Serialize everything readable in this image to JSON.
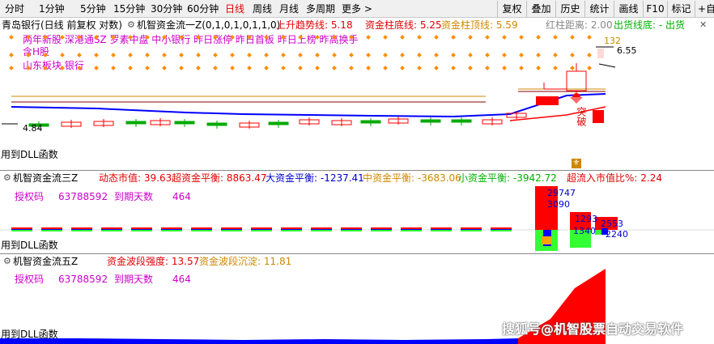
{
  "toolbar": {
    "periods": [
      "分时",
      "1分钟",
      "5分钟",
      "15分钟",
      "30分钟",
      "60分钟",
      "日线",
      "周线",
      "月线",
      "多周期",
      "更多 >"
    ],
    "active_period": "日线",
    "buttons": [
      "复权",
      "叠加",
      "历史",
      "统计",
      "画线",
      "F10",
      "标记",
      "+自"
    ]
  },
  "main_pane": {
    "title": "青岛银行(日线 前复权 对数)",
    "indicator": "机智资金流一Z(0,1,0,1,0,1,1,0)",
    "trend_line": "上升趋势线: 5.18",
    "fund_bottom": "资金柱底线: 5.25",
    "fund_top": "资金柱顶线: 5.59",
    "red_distance": "红柱距离: 2.00",
    "sell_line": "出货线底: - 出货",
    "concepts_line1": "两年新股 深港通SZ 罗素中盘 中小银行 昨日涨停 昨日首板 昨日上榜 昨高换手",
    "concepts_line2": "含H股",
    "concepts_line3": "山东板块   银行",
    "price_low": "4.84",
    "price_high": "6.55",
    "price_mark": "132",
    "breakout_label": "突破",
    "dll": "用到DLL函数"
  },
  "pane2": {
    "title": "机智资金流三Z",
    "dynamic_cap": "动态市值: 39.63",
    "super_flow": "超资金平衡: 8863.47",
    "big_flow": "大资金平衡: -1237.41",
    "mid_flow": "中资金平衡: -3683.06",
    "small_flow": "小资金平衡: -3942.72",
    "super_ratio": "超流入市值比%: 2.24",
    "auth_label": "授权码",
    "auth_code": "63788592",
    "expire_label": "到期天数",
    "expire_days": "464",
    "val1": "29747",
    "val2": "3090",
    "val3": "1293",
    "val4": "2553",
    "val5": "1340",
    "val6": "2240",
    "dll": "用到DLL函数"
  },
  "pane3": {
    "title": "机智资金流五Z",
    "strength": "资金波段强度: 13.57",
    "sediment": "资金波段沉淀: 11.81",
    "auth_label": "授权码",
    "auth_code": "63788592",
    "expire_label": "到期天数",
    "expire_days": "464",
    "dll": "用到DLL函数"
  },
  "watermark": "搜狐号@机智股票自动交易软件",
  "colors": {
    "up": "#ff0000",
    "down": "#00aa00",
    "trend": "#0000ff",
    "orange_dot": "#ff8c00",
    "magenta": "#cc00cc",
    "toolbar_bg": "#f0f0f0"
  }
}
